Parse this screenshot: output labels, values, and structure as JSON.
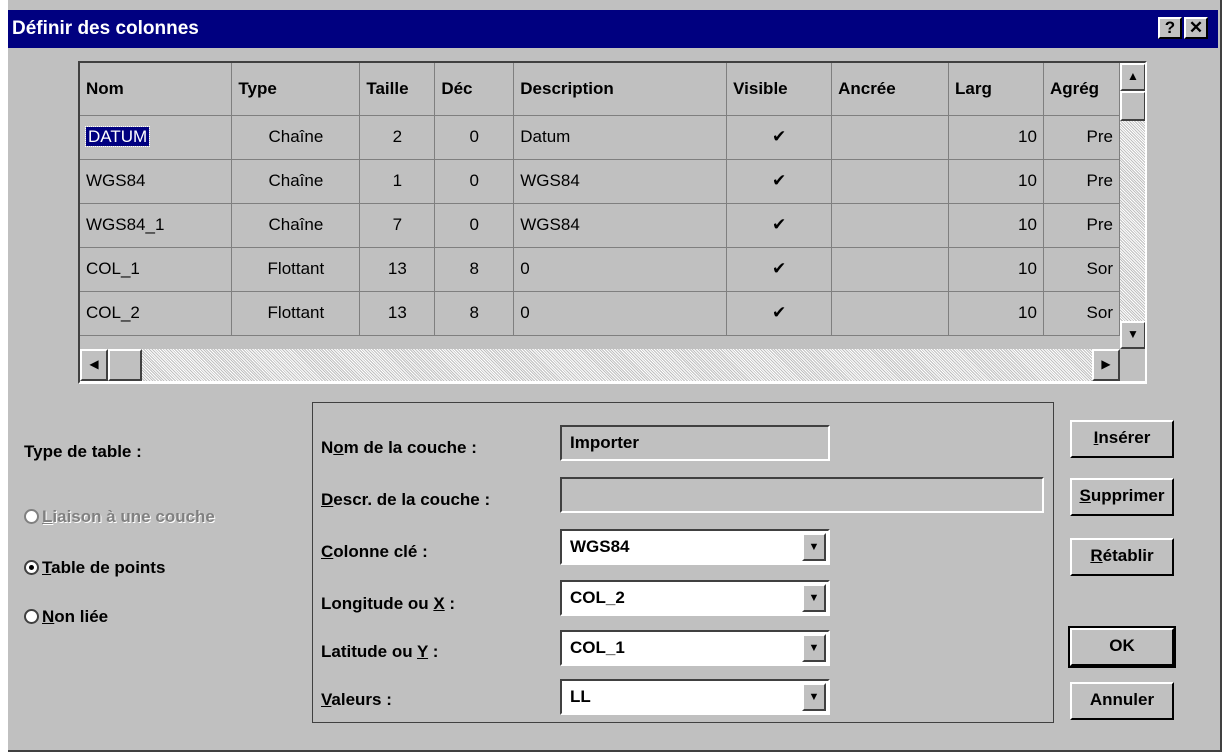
{
  "window": {
    "title": "Définir des colonnes",
    "help_label": "?",
    "close_label": "✕"
  },
  "grid": {
    "columns": [
      "Nom",
      "Type",
      "Taille",
      "Déc",
      "Description",
      "Visible",
      "Ancrée",
      "Larg",
      "Agrég"
    ],
    "rows": [
      {
        "nom": "DATUM",
        "type": "Chaîne",
        "taille": "2",
        "dec": "0",
        "desc": "Datum",
        "visible": "✔",
        "ancree": "",
        "larg": "10",
        "agreg": "Pre"
      },
      {
        "nom": "WGS84",
        "type": "Chaîne",
        "taille": "1",
        "dec": "0",
        "desc": "WGS84",
        "visible": "✔",
        "ancree": "",
        "larg": "10",
        "agreg": "Pre"
      },
      {
        "nom": "WGS84_1",
        "type": "Chaîne",
        "taille": "7",
        "dec": "0",
        "desc": "WGS84",
        "visible": "✔",
        "ancree": "",
        "larg": "10",
        "agreg": "Pre"
      },
      {
        "nom": "COL_1",
        "type": "Flottant",
        "taille": "13",
        "dec": "8",
        "desc": "0",
        "visible": "✔",
        "ancree": "",
        "larg": "10",
        "agreg": "Sor"
      },
      {
        "nom": "COL_2",
        "type": "Flottant",
        "taille": "13",
        "dec": "8",
        "desc": "0",
        "visible": "✔",
        "ancree": "",
        "larg": "10",
        "agreg": "Sor"
      }
    ]
  },
  "table_type": {
    "heading": "Type de table :",
    "options": [
      {
        "label_pre": "",
        "label_u": "L",
        "label_post": "iaison à une couche",
        "selected": false,
        "disabled": true
      },
      {
        "label_pre": "",
        "label_u": "T",
        "label_post": "able de points",
        "selected": true,
        "disabled": false
      },
      {
        "label_pre": "",
        "label_u": "N",
        "label_post": "on liée",
        "selected": false,
        "disabled": false
      }
    ]
  },
  "layer": {
    "name_label_pre": "N",
    "name_label_u": "o",
    "name_label_post": "m de la couche :",
    "name_value": "Importer",
    "descr_label_u": "D",
    "descr_label_post": "escr. de la couche :",
    "descr_value": "",
    "key_label_u": "C",
    "key_label_post": "olonne clé :",
    "key_value": "WGS84",
    "lon_label_pre": "Longitude ou ",
    "lon_label_u": "X",
    "lon_label_post": " :",
    "lon_value": "COL_2",
    "lat_label_pre": "Latitude ou ",
    "lat_label_u": "Y",
    "lat_label_post": " :",
    "lat_value": "COL_1",
    "val_label_u": "V",
    "val_label_post": "aleurs :",
    "val_value": "LL"
  },
  "buttons": {
    "insert_u": "I",
    "insert_post": "nsérer",
    "delete_u": "S",
    "delete_post": "upprimer",
    "reset_u": "R",
    "reset_post": "établir",
    "ok": "OK",
    "cancel": "Annuler"
  }
}
